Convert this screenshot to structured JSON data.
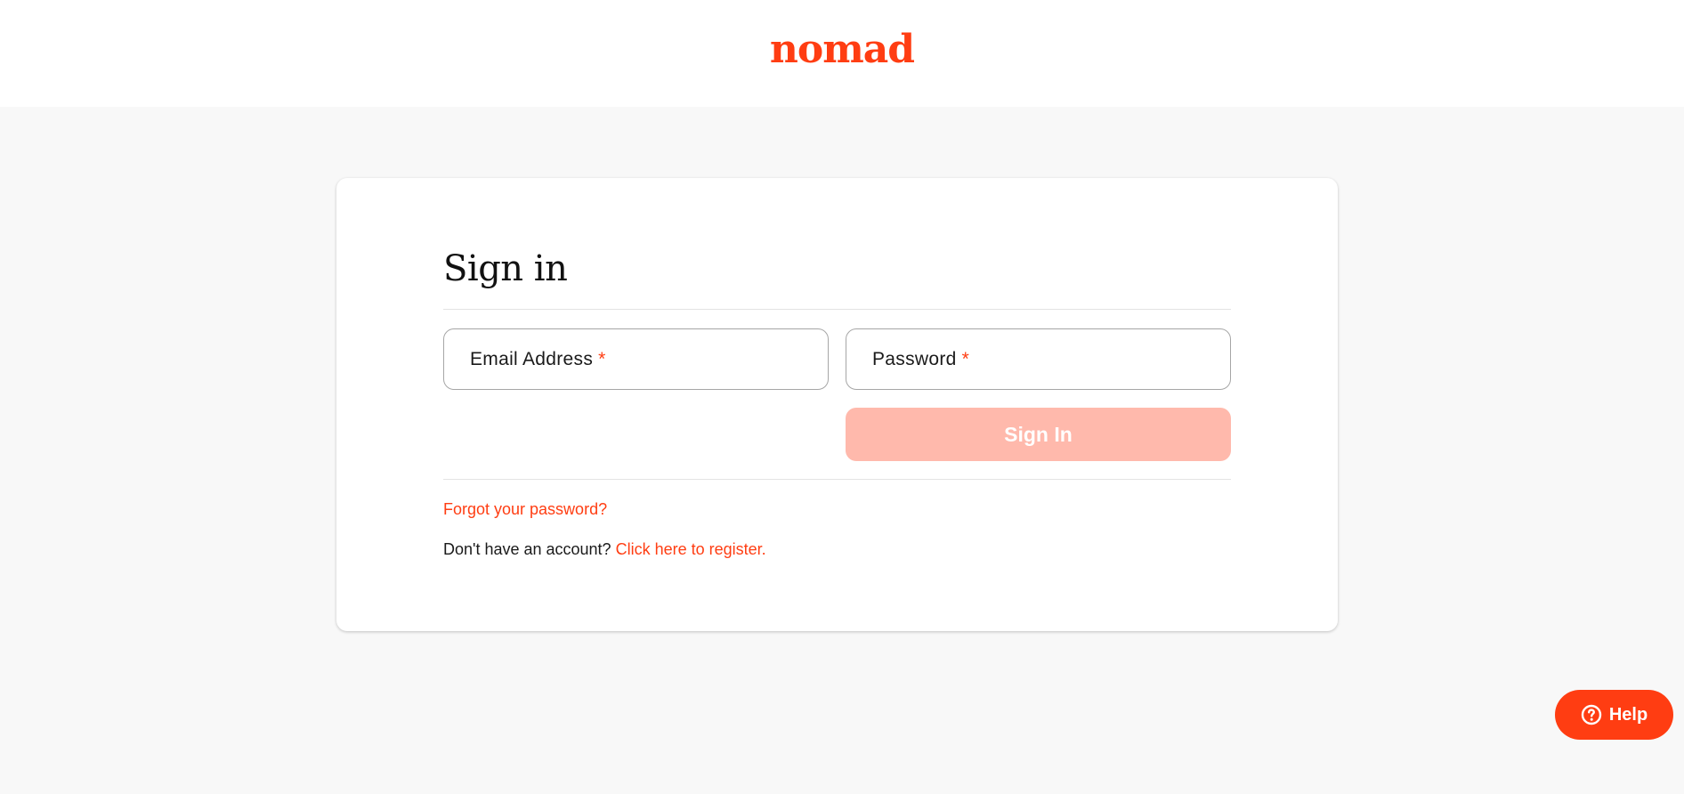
{
  "brand": {
    "logo_text": "nomad",
    "accent_color": "#ff3d12"
  },
  "form": {
    "heading": "Sign in",
    "email_label": "Email Address",
    "password_label": "Password",
    "required_marker": "*",
    "submit_label": "Sign In",
    "submit_state": "disabled"
  },
  "links": {
    "forgot_password": "Forgot your password?",
    "register_prompt": "Don't have an account?",
    "register_link": "Click here to register."
  },
  "help": {
    "label": "Help",
    "icon": "question-circle-icon"
  }
}
